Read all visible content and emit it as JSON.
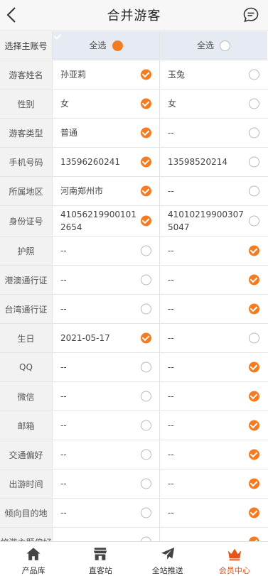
{
  "header": {
    "title": "合并游客"
  },
  "select_all": {
    "row_label": "选择主账号",
    "left_label": "全选",
    "right_label": "全选",
    "left_selected": true,
    "right_selected": false
  },
  "rows": [
    {
      "label": "游客姓名",
      "left": "孙亚莉",
      "left_on": true,
      "right": "玉兔",
      "right_on": false
    },
    {
      "label": "性别",
      "left": "女",
      "left_on": true,
      "right": "女",
      "right_on": false
    },
    {
      "label": "游客类型",
      "left": "普通",
      "left_on": true,
      "right": "--",
      "right_on": false
    },
    {
      "label": "手机号码",
      "left": "13596260241",
      "left_on": true,
      "right": "13598520214",
      "right_on": false
    },
    {
      "label": "所属地区",
      "left": "河南郑州市",
      "left_on": true,
      "right": "--",
      "right_on": false
    },
    {
      "label": "身份证号",
      "left": "410562199001012654",
      "left_on": true,
      "right": "410102199003075047",
      "right_on": false
    },
    {
      "label": "护照",
      "left": "--",
      "left_on": false,
      "right": "--",
      "right_on": true
    },
    {
      "label": "港澳通行证",
      "left": "--",
      "left_on": false,
      "right": "--",
      "right_on": true
    },
    {
      "label": "台湾通行证",
      "left": "--",
      "left_on": false,
      "right": "--",
      "right_on": true
    },
    {
      "label": "生日",
      "left": "2021-05-17",
      "left_on": true,
      "right": "--",
      "right_on": false
    },
    {
      "label": "QQ",
      "left": "--",
      "left_on": false,
      "right": "--",
      "right_on": true
    },
    {
      "label": "微信",
      "left": "--",
      "left_on": false,
      "right": "--",
      "right_on": true
    },
    {
      "label": "邮箱",
      "left": "--",
      "left_on": false,
      "right": "--",
      "right_on": true
    },
    {
      "label": "交通偏好",
      "left": "--",
      "left_on": false,
      "right": "--",
      "right_on": true
    },
    {
      "label": "出游时间",
      "left": "--",
      "left_on": false,
      "right": "--",
      "right_on": true
    },
    {
      "label": "倾向目的地",
      "left": "--",
      "left_on": false,
      "right": "--",
      "right_on": true
    },
    {
      "label": "旅游主题偏好",
      "left": "--",
      "left_on": false,
      "right": "--",
      "right_on": true
    }
  ],
  "tabbar": [
    {
      "label": "产品库",
      "icon": "home-icon",
      "active": false
    },
    {
      "label": "直客站",
      "icon": "store-icon",
      "active": false
    },
    {
      "label": "全站推送",
      "icon": "send-icon",
      "active": false
    },
    {
      "label": "会员中心",
      "icon": "crown-icon",
      "active": true
    }
  ],
  "colors": {
    "accent": "#f47b1f",
    "active_tab": "#e8541a",
    "header_select_bg": "#e6ebf3",
    "label_bg": "#f2f2f2"
  }
}
